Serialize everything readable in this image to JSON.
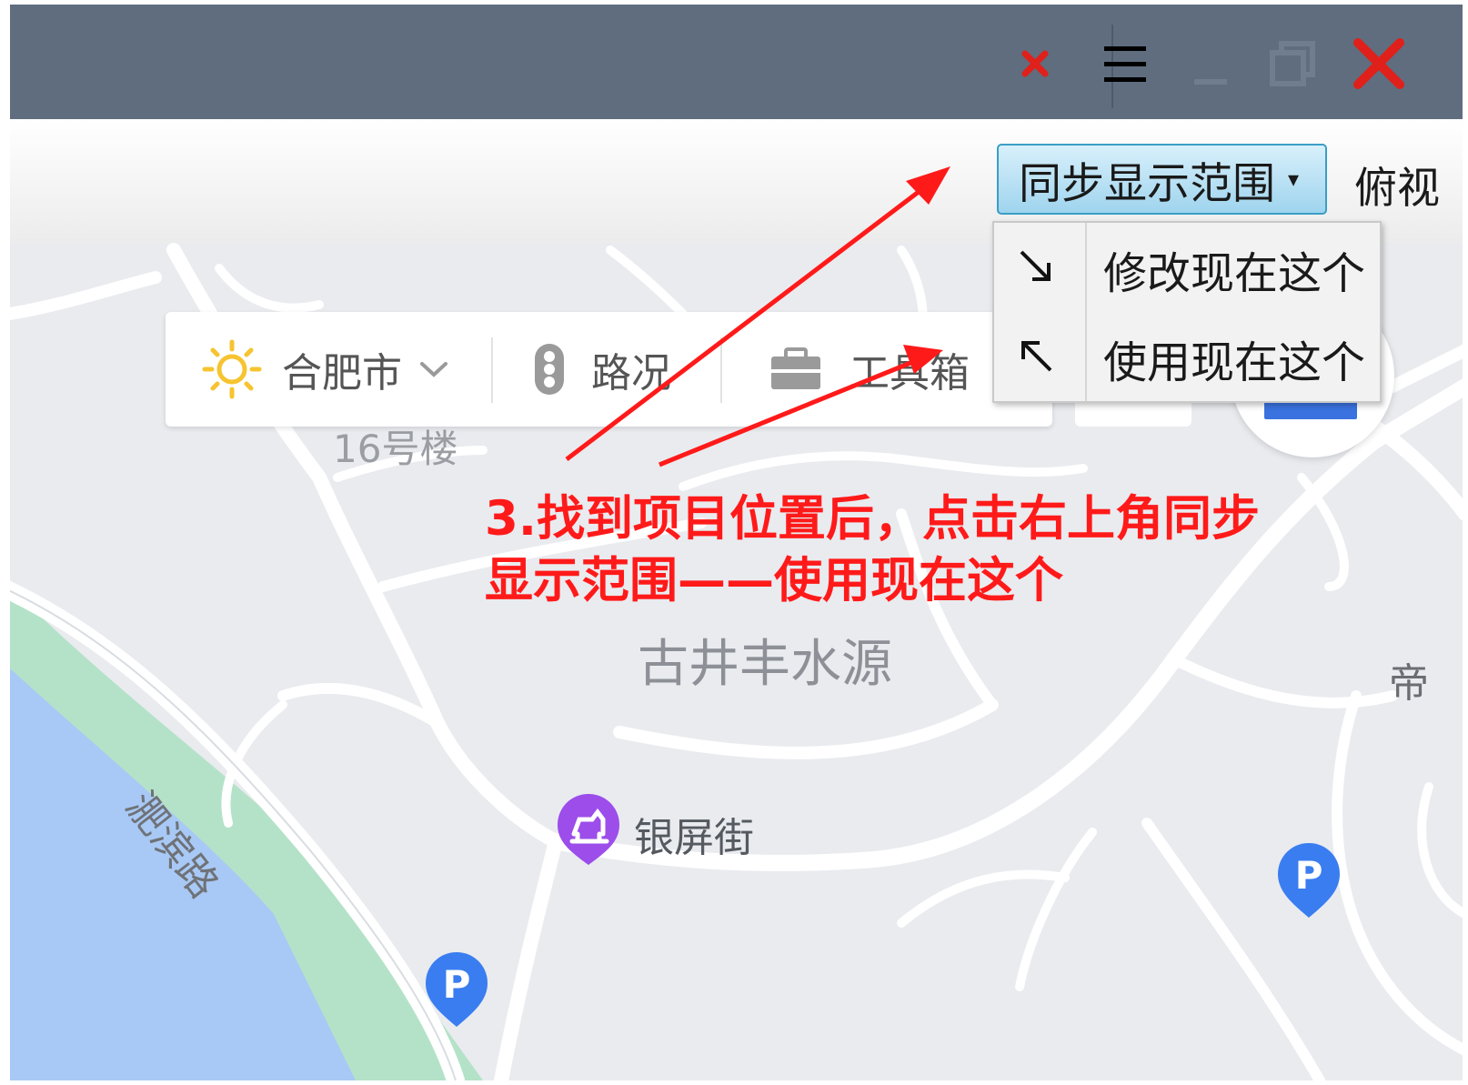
{
  "window": {
    "titlebar_color": "#5f6d7f",
    "controls": [
      {
        "name": "small-close-icon",
        "glyph": "✕",
        "color": "#e0201a"
      },
      {
        "name": "menu-icon",
        "glyph": "☰"
      },
      {
        "name": "minimize-icon"
      },
      {
        "name": "restore-icon"
      },
      {
        "name": "close-icon",
        "color": "#e0201a"
      }
    ]
  },
  "toolbar": {
    "sync_label": "同步显示范围",
    "sync_caret": "▾",
    "view_label": "俯视"
  },
  "dropdown": {
    "items": [
      {
        "icon": "arrow-down-right-icon",
        "glyph": "➘",
        "label": "修改现在这个"
      },
      {
        "icon": "arrow-up-left-icon",
        "glyph": "➘",
        "label": "使用现在这个"
      }
    ]
  },
  "map_panel": {
    "city": "合肥市",
    "traffic": "路况",
    "toolbox": "工具箱"
  },
  "map_labels": {
    "building": "16号楼",
    "water": "古井丰水源",
    "road": "淝滨路",
    "street": "银屏街",
    "edge": "帝"
  },
  "annotation": {
    "line1": "3.找到项目位置后，点击右上角同步",
    "line2": "显示范围——使用现在这个",
    "color": "#ff1a1a"
  },
  "colors": {
    "map_background": "#e9ebef",
    "road": "#ffffff",
    "river": "#a8c9f5",
    "riverbank": "#b4e2c8",
    "poi_blue": "#3a7df0",
    "poi_purple": "#9c4dea"
  }
}
